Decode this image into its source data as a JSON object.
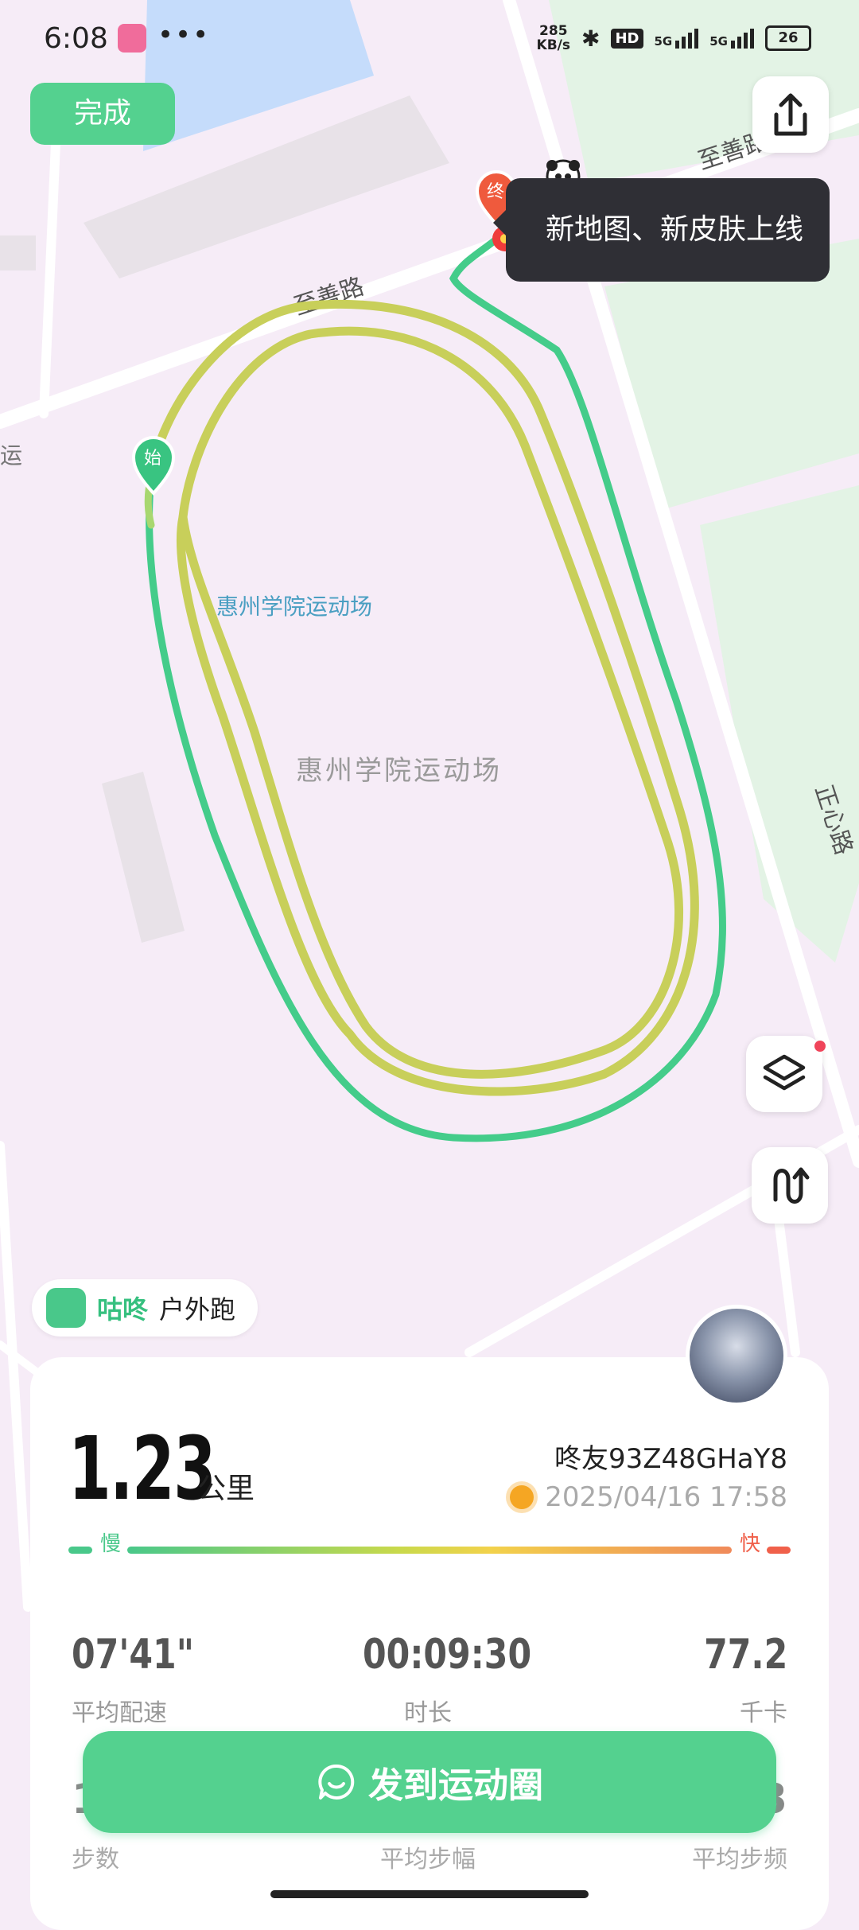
{
  "status_bar": {
    "time": "6:08",
    "dots": "•••",
    "net_speed_value": "285",
    "net_speed_unit": "KB/s",
    "bluetooth": "✱",
    "hd": "HD",
    "sim1": "5G",
    "sim2": "5G",
    "battery": "26"
  },
  "map": {
    "roads": [
      "至善路",
      "至善路",
      "正心路"
    ],
    "road_fragment": "运",
    "venue_label": "惠州学院运动场",
    "venue_center_label": "惠州学院运动场",
    "start_marker": "始",
    "end_marker": "终",
    "tooltip": "新地图、新皮肤上线"
  },
  "top": {
    "done_label": "完成"
  },
  "badge": {
    "brand": "咕咚",
    "activity": "户外跑"
  },
  "summary": {
    "distance": "1.23",
    "distance_unit": "公里",
    "user": "咚友93Z48GHaY8",
    "datetime": "2025/04/16 17:58",
    "slow_label": "慢",
    "fast_label": "快"
  },
  "stats": [
    {
      "value": "07'41\"",
      "label": "平均配速"
    },
    {
      "value": "00:09:30",
      "label": "时长"
    },
    {
      "value": "77.2",
      "label": "千卡"
    }
  ],
  "stats_row2": {
    "left_value": "1",
    "right_value": "3",
    "left_label": "步数",
    "mid_label": "平均步幅",
    "right_label": "平均步频"
  },
  "post_button": "发到运动圈",
  "colors": {
    "accent": "#54d18f",
    "route_outer": "#44cc8a",
    "route_inner": "#c8cf5a",
    "map_bg": "#f6ecf7",
    "green_area": "#e3f3e5"
  }
}
